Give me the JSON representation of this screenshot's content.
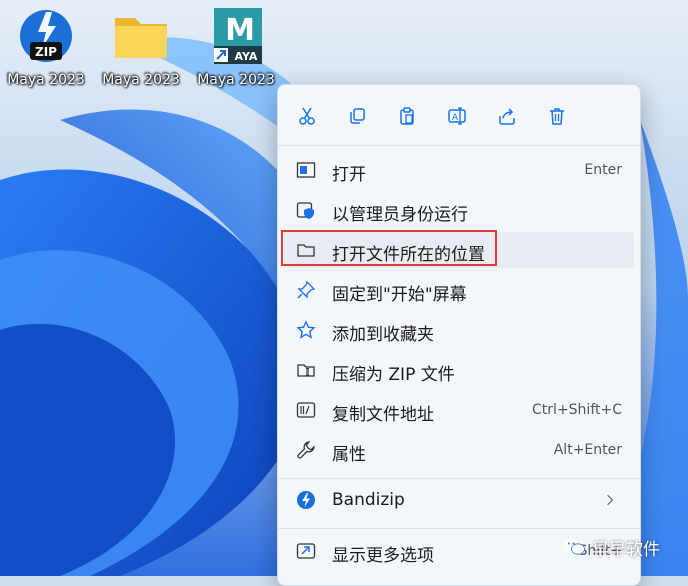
{
  "desktop": {
    "icons": [
      {
        "label": "Maya 2023",
        "icon": "zip-archive-icon",
        "badge": "ZIP"
      },
      {
        "label": "Maya 2023",
        "icon": "folder-icon"
      },
      {
        "label": "Maya 2023",
        "icon": "maya-app-shortcut-icon",
        "letter": "M",
        "badge": "AYA"
      }
    ]
  },
  "context_menu": {
    "toolbar": [
      {
        "name": "cut",
        "icon": "scissors-icon"
      },
      {
        "name": "copy",
        "icon": "copy-icon"
      },
      {
        "name": "paste",
        "icon": "clipboard-icon"
      },
      {
        "name": "rename",
        "icon": "rename-icon"
      },
      {
        "name": "share",
        "icon": "share-icon"
      },
      {
        "name": "delete",
        "icon": "trash-icon"
      }
    ],
    "items": [
      {
        "label": "打开",
        "shortcut": "Enter",
        "icon": "open-window-icon"
      },
      {
        "label": "以管理员身份运行",
        "shortcut": "",
        "icon": "admin-shield-icon"
      },
      {
        "label": "打开文件所在的位置",
        "shortcut": "",
        "icon": "folder-outline-icon"
      },
      {
        "label": "固定到\"开始\"屏幕",
        "shortcut": "",
        "icon": "pin-icon"
      },
      {
        "label": "添加到收藏夹",
        "shortcut": "",
        "icon": "star-icon"
      },
      {
        "label": "压缩为 ZIP 文件",
        "shortcut": "",
        "icon": "zip-folder-icon"
      },
      {
        "label": "复制文件地址",
        "shortcut": "Ctrl+Shift+C",
        "icon": "copy-path-icon"
      },
      {
        "label": "属性",
        "shortcut": "Alt+Enter",
        "icon": "wrench-icon"
      },
      {
        "label": "Bandizip",
        "shortcut": "",
        "icon": "bandizip-icon",
        "has_submenu": true
      },
      {
        "label": "显示更多选项",
        "shortcut": "Shift+",
        "icon": "more-options-icon"
      }
    ],
    "highlighted_item": "打开文件所在的位置"
  },
  "watermark": {
    "text": "早早软件",
    "icon": "wechat-icon"
  },
  "colors": {
    "accent": "#1a73e8",
    "highlight_border": "#e03a3a",
    "menu_bg": "#f3f6fb"
  }
}
